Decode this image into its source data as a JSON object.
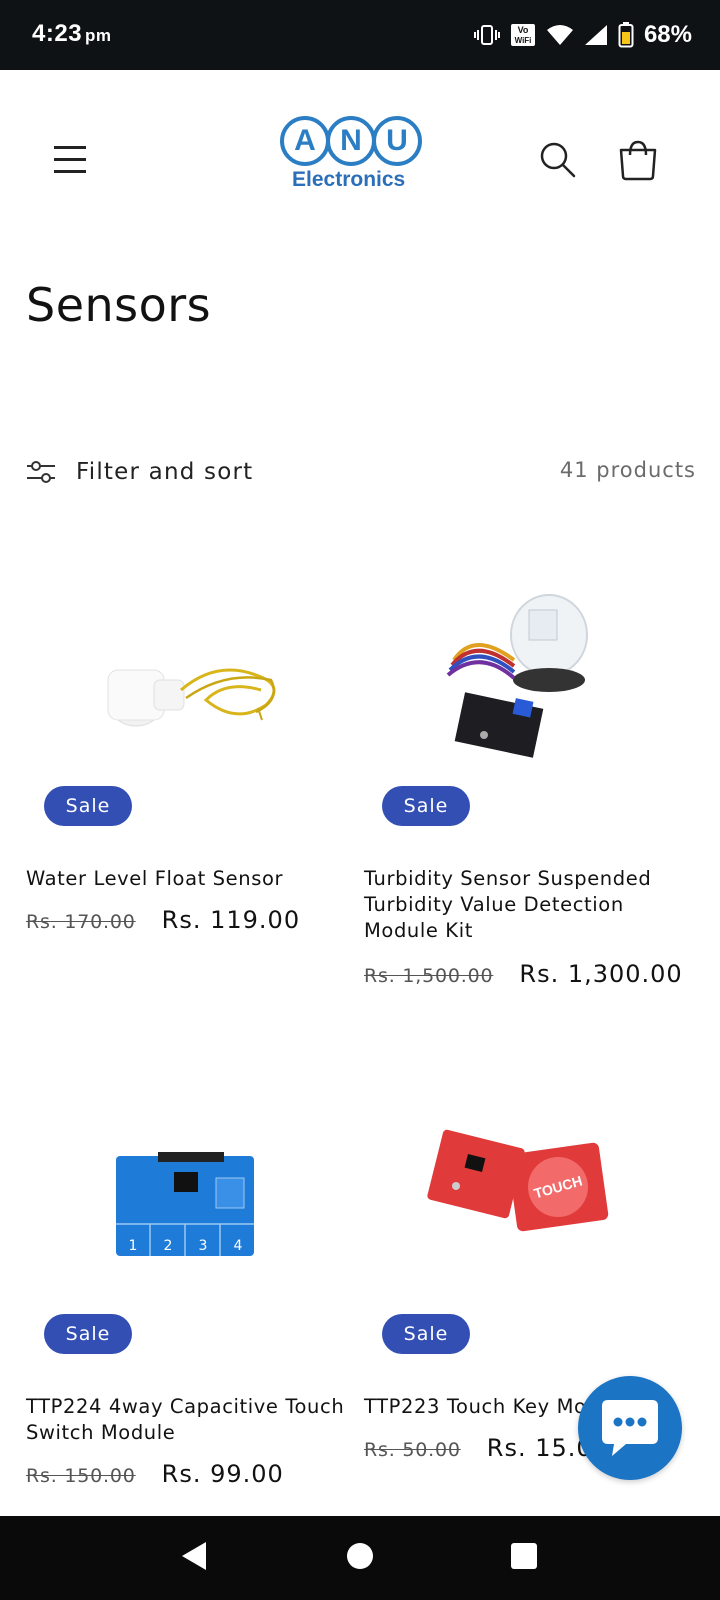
{
  "status_bar": {
    "time": "4:23",
    "ampm": "pm",
    "volte": "Vo",
    "wifi_text": "WiFi",
    "battery_percent": "68%"
  },
  "header": {
    "logo_letters": [
      "A",
      "N",
      "U"
    ],
    "logo_subtitle": "Electronics",
    "menu_icon": "hamburger-menu-icon",
    "search_icon": "search-icon",
    "cart_icon": "cart-icon"
  },
  "collection": {
    "title": "Sensors",
    "filter_label": "Filter and sort",
    "product_count": "41 products"
  },
  "products": [
    {
      "badge": "Sale",
      "name": "Water Level Float Sensor",
      "old_price": "Rs. 170.00",
      "price": "Rs. 119.00",
      "image": "float-sensor-image"
    },
    {
      "badge": "Sale",
      "name": "Turbidity Sensor Suspended Turbidity Value Detection Module Kit",
      "old_price": "Rs. 1,500.00",
      "price": "Rs. 1,300.00",
      "image": "turbidity-sensor-image"
    },
    {
      "badge": "Sale",
      "name": "TTP224 4way Capacitive Touch Switch Module",
      "old_price": "Rs. 150.00",
      "price": "Rs. 99.00",
      "image": "ttp224-board-image",
      "pad_labels": [
        "1",
        "2",
        "3",
        "4"
      ]
    },
    {
      "badge": "Sale",
      "name": "TTP223 Touch Key Mod",
      "old_price": "Rs. 50.00",
      "price": "Rs. 15.00",
      "image": "ttp223-board-image",
      "board_label": "TOUCH"
    }
  ],
  "chat": {
    "icon": "chat-bubble-icon"
  },
  "nav_bar": {
    "back": "back-icon",
    "home": "home-icon",
    "recents": "recents-icon"
  },
  "colors": {
    "accent": "#334fb4",
    "logo_blue": "#2b7ec4",
    "chat_blue": "#1b74c4"
  }
}
